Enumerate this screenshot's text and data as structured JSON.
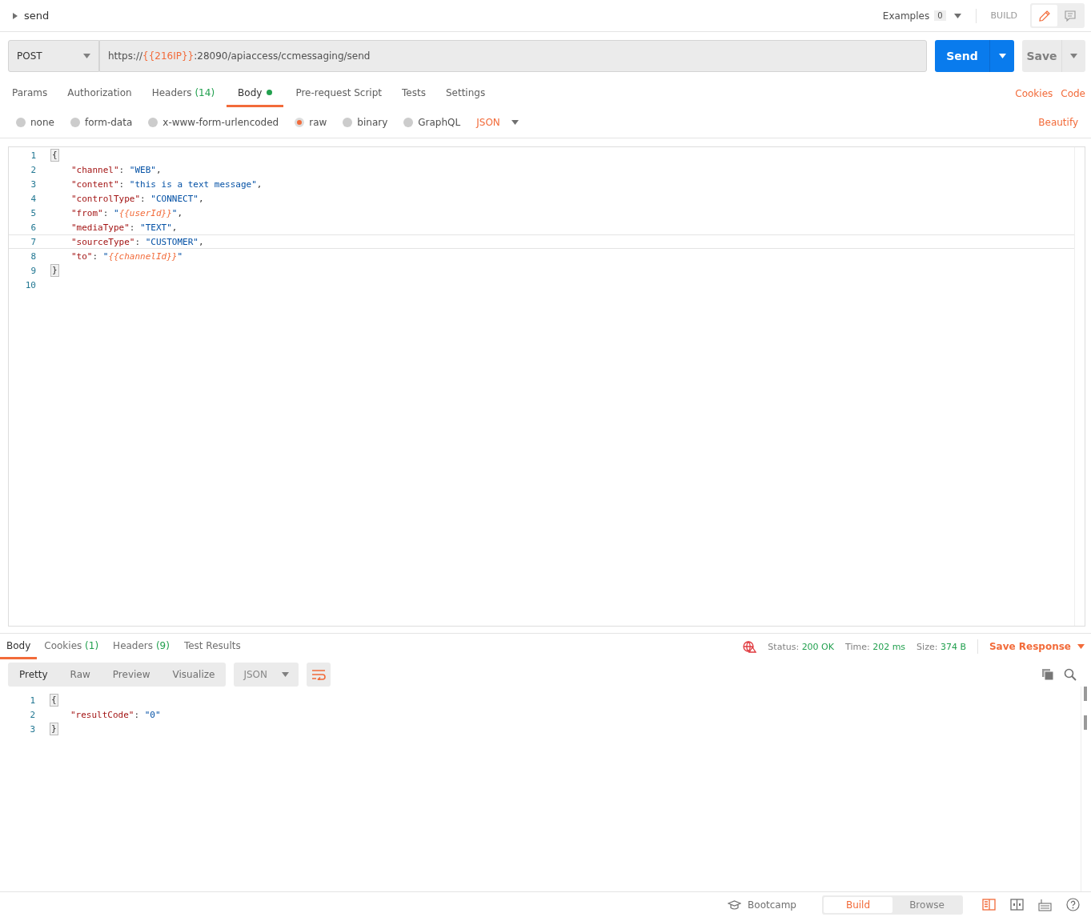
{
  "request": {
    "name": "send",
    "examples_label": "Examples",
    "examples_count": "0",
    "mode_label": "BUILD",
    "view_toggle": [
      {
        "kind": "edit",
        "selected": true
      },
      {
        "kind": "comments",
        "selected": false
      }
    ],
    "method": "POST",
    "url": [
      {
        "kind": "plain",
        "text": "https://"
      },
      {
        "kind": "var",
        "text": "{{216IP}}"
      },
      {
        "kind": "plain",
        "text": ":28090/apiaccess/ccmessaging/send"
      }
    ],
    "send_label": "Send",
    "save_label": "Save"
  },
  "tabs": [
    {
      "label": "Params",
      "selected": false,
      "dot": false
    },
    {
      "label": "Authorization",
      "selected": false,
      "dot": false
    },
    {
      "label": "Headers",
      "count": "(14)",
      "selected": false,
      "dot": false
    },
    {
      "label": "Body",
      "selected": true,
      "dot": true
    },
    {
      "label": "Pre-request Script",
      "selected": false,
      "dot": false
    },
    {
      "label": "Tests",
      "selected": false,
      "dot": false
    },
    {
      "label": "Settings",
      "selected": false,
      "dot": false
    }
  ],
  "tab_links": [
    "Cookies",
    "Code"
  ],
  "body_types": [
    {
      "label": "none",
      "selected": false
    },
    {
      "label": "form-data",
      "selected": false
    },
    {
      "label": "x-www-form-urlencoded",
      "selected": false
    },
    {
      "label": "raw",
      "selected": true
    },
    {
      "label": "binary",
      "selected": false
    },
    {
      "label": "GraphQL",
      "selected": false
    }
  ],
  "raw_format": "JSON",
  "beautify": "Beautify",
  "request_body": [
    {
      "number": "1",
      "kind": "brace",
      "current": false,
      "tokens": [
        {
          "kind": "punct",
          "text": "{"
        }
      ]
    },
    {
      "number": "2",
      "kind": "member",
      "current": false,
      "tokens": [
        {
          "kind": "key",
          "text": "\"channel\""
        },
        {
          "kind": "punct",
          "text": ": "
        },
        {
          "kind": "str",
          "text": "\"WEB\""
        },
        {
          "kind": "punct",
          "text": ","
        }
      ]
    },
    {
      "number": "3",
      "kind": "member",
      "current": false,
      "tokens": [
        {
          "kind": "key",
          "text": "\"content\""
        },
        {
          "kind": "punct",
          "text": ": "
        },
        {
          "kind": "str",
          "text": "\"this is a text message\""
        },
        {
          "kind": "punct",
          "text": ","
        }
      ]
    },
    {
      "number": "4",
      "kind": "member",
      "current": false,
      "tokens": [
        {
          "kind": "key",
          "text": "\"controlType\""
        },
        {
          "kind": "punct",
          "text": ": "
        },
        {
          "kind": "str",
          "text": "\"CONNECT\""
        },
        {
          "kind": "punct",
          "text": ","
        }
      ]
    },
    {
      "number": "5",
      "kind": "member",
      "current": false,
      "tokens": [
        {
          "kind": "key",
          "text": "\"from\""
        },
        {
          "kind": "punct",
          "text": ": "
        },
        {
          "kind": "str",
          "text": "\""
        },
        {
          "kind": "var",
          "text": "{{userId}}"
        },
        {
          "kind": "str",
          "text": "\""
        },
        {
          "kind": "punct",
          "text": ","
        }
      ]
    },
    {
      "number": "6",
      "kind": "member",
      "current": false,
      "tokens": [
        {
          "kind": "key",
          "text": "\"mediaType\""
        },
        {
          "kind": "punct",
          "text": ": "
        },
        {
          "kind": "str",
          "text": "\"TEXT\""
        },
        {
          "kind": "punct",
          "text": ","
        }
      ]
    },
    {
      "number": "7",
      "kind": "member",
      "current": true,
      "tokens": [
        {
          "kind": "key",
          "text": "\"sourceType\""
        },
        {
          "kind": "punct",
          "text": ": "
        },
        {
          "kind": "str",
          "text": "\"CUSTOMER\""
        },
        {
          "kind": "punct",
          "text": ","
        }
      ]
    },
    {
      "number": "8",
      "kind": "member",
      "current": false,
      "tokens": [
        {
          "kind": "key",
          "text": "\"to\""
        },
        {
          "kind": "punct",
          "text": ": "
        },
        {
          "kind": "str",
          "text": "\""
        },
        {
          "kind": "var",
          "text": "{{channelId}}"
        },
        {
          "kind": "str",
          "text": "\""
        }
      ]
    },
    {
      "number": "9",
      "kind": "brace",
      "current": false,
      "tokens": [
        {
          "kind": "punct",
          "text": "}"
        }
      ]
    },
    {
      "number": "10",
      "current": false
    }
  ],
  "response": {
    "tabs": [
      {
        "label": "Body",
        "selected": true
      },
      {
        "label": "Cookies",
        "count": "(1)",
        "selected": false
      },
      {
        "label": "Headers",
        "count": "(9)",
        "selected": false
      },
      {
        "label": "Test Results",
        "selected": false
      }
    ],
    "stats": [
      {
        "label": "Status:",
        "value": "200 OK"
      },
      {
        "label": "Time:",
        "value": "202 ms"
      },
      {
        "label": "Size:",
        "value": "374 B"
      }
    ],
    "save_label": "Save Response",
    "views": [
      {
        "label": "Pretty",
        "selected": true
      },
      {
        "label": "Raw",
        "selected": false
      },
      {
        "label": "Preview",
        "selected": false
      },
      {
        "label": "Visualize",
        "selected": false
      }
    ],
    "format": "JSON",
    "body": [
      {
        "number": "1",
        "kind": "brace",
        "tokens": [
          {
            "kind": "punct",
            "text": "{"
          }
        ]
      },
      {
        "number": "2",
        "kind": "member",
        "tokens": [
          {
            "kind": "key",
            "text": "\"resultCode\""
          },
          {
            "kind": "punct",
            "text": ": "
          },
          {
            "kind": "str",
            "text": "\"0\""
          }
        ]
      },
      {
        "number": "3",
        "kind": "brace",
        "tokens": [
          {
            "kind": "punct",
            "text": "}"
          }
        ]
      }
    ]
  },
  "footer": {
    "bootcamp": "Bootcamp",
    "modes": [
      {
        "label": "Build",
        "selected": true
      },
      {
        "label": "Browse",
        "selected": false
      }
    ]
  }
}
